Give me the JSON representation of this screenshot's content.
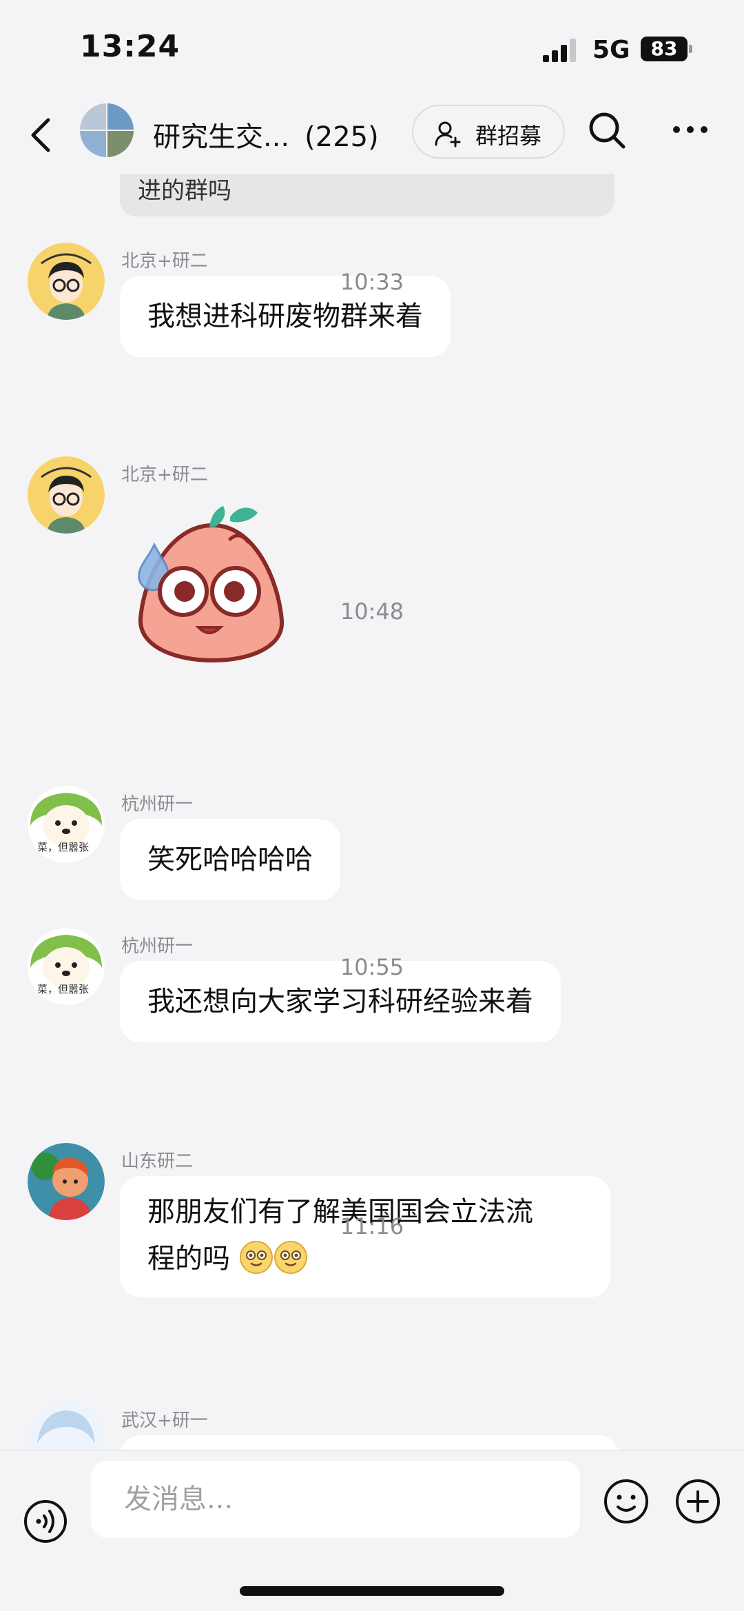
{
  "status_bar": {
    "time": "13:24",
    "network": "5G",
    "battery": "83"
  },
  "header": {
    "title": "研究生交...",
    "member_count": "(225)",
    "recruit_label": "群招募"
  },
  "top_bubble": {
    "text": "进的群吗"
  },
  "messages": [
    {
      "sender": "北京+研二",
      "text": "我想进科研废物群来着"
    },
    {
      "time": "10:33"
    },
    {
      "sender": "北京+研二",
      "sticker": "peach-sweat-sticker"
    },
    {
      "time": "10:48"
    },
    {
      "sender": "杭州研一",
      "text": "笑死哈哈哈哈",
      "avatar_caption": "菜，但嚣张"
    },
    {
      "sender": "杭州研一",
      "text": "我还想向大家学习科研经验来着",
      "avatar_caption": "菜，但嚣张"
    },
    {
      "time": "10:55"
    },
    {
      "sender": "山东研二",
      "text_line1": "那朋友们有了解美国国会立法流",
      "text_line2": "程的吗"
    },
    {
      "time": "11:16"
    },
    {
      "sender": "武汉+研一"
    }
  ],
  "input": {
    "placeholder": "发消息..."
  },
  "colors": {
    "background": "#f4f4f6",
    "bubble": "#ffffff",
    "meta_text": "#8a8a8f"
  },
  "icons": [
    "back-icon",
    "search-icon",
    "more-icon",
    "add-person-icon",
    "voice-icon",
    "emoji-icon",
    "plus-icon"
  ]
}
